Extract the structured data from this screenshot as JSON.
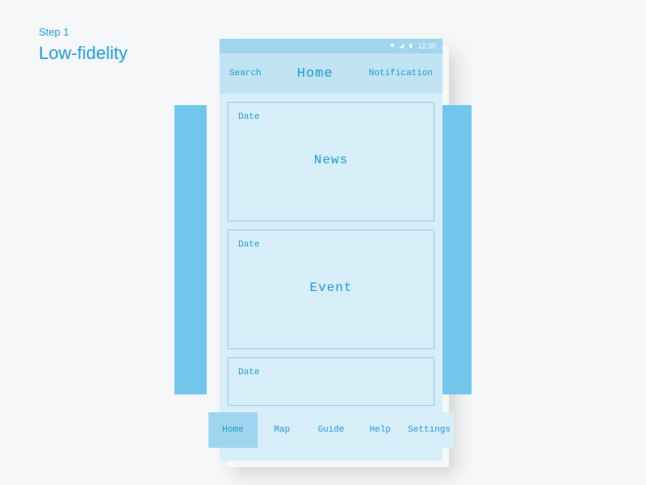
{
  "title": {
    "step": "Step 1",
    "fidelity": "Low-fidelity"
  },
  "status_bar": {
    "time": "12:30",
    "icons": [
      "heart",
      "signal",
      "lock"
    ]
  },
  "top_nav": {
    "left": "Search",
    "center": "Home",
    "right": "Notification"
  },
  "cards": [
    {
      "date_label": "Date",
      "title": "News"
    },
    {
      "date_label": "Date",
      "title": "Event"
    },
    {
      "date_label": "Date",
      "title": ""
    }
  ],
  "bottom_nav": {
    "items": [
      {
        "label": "Home",
        "active": true
      },
      {
        "label": "Map",
        "active": false
      },
      {
        "label": "Guide",
        "active": false
      },
      {
        "label": "Help",
        "active": false
      },
      {
        "label": "Settings",
        "active": false
      }
    ]
  },
  "colors": {
    "primary": "#1a9acc",
    "light_bg": "#d8eef9",
    "mid_bg": "#c2e3f3",
    "status_bg": "#9fd5ee",
    "accent": "#72c6ec"
  }
}
